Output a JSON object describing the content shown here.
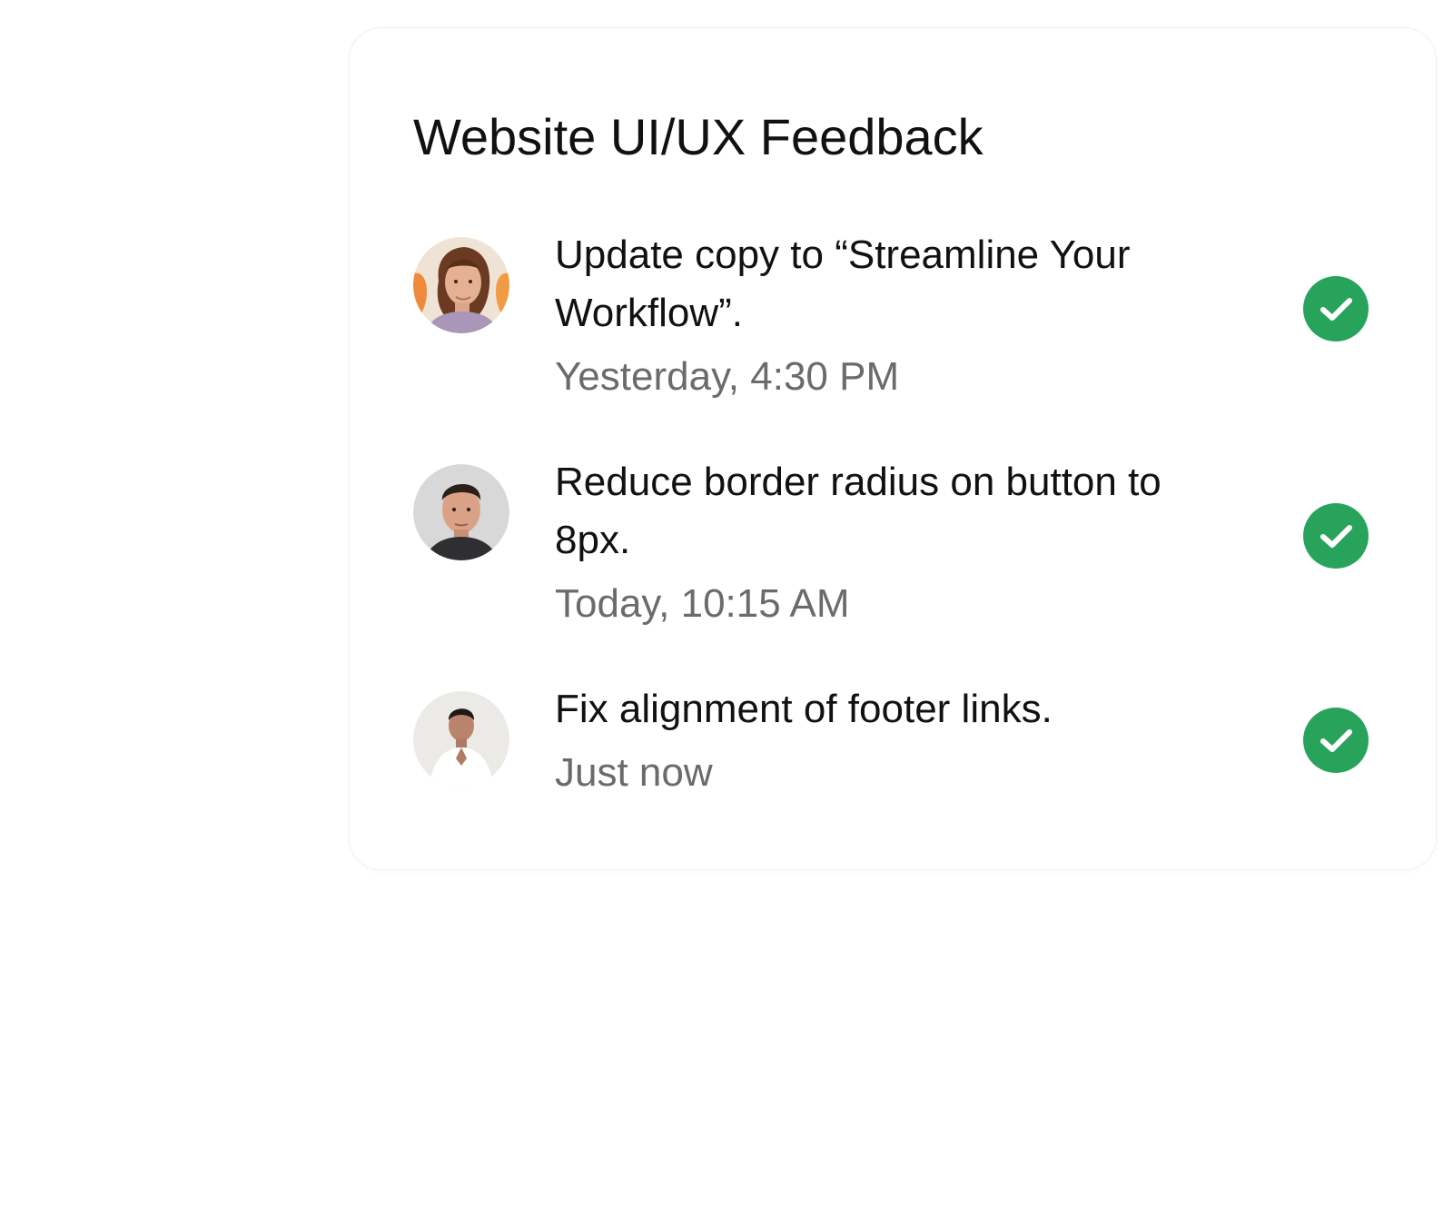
{
  "title": "Website UI/UX Feedback",
  "colors": {
    "check": "#27a35b",
    "meta": "#6b6b6b",
    "text": "#111111"
  },
  "items": [
    {
      "text": "Update copy to “Streamline Your\nWorkflow”.",
      "time": "Yesterday, 4:30 PM",
      "avatar_icon": "avatar-woman-curly-hair",
      "status_icon": "check-circle-icon"
    },
    {
      "text": "Reduce border radius on button to\n8px.",
      "time": "Today, 10:15 AM",
      "avatar_icon": "avatar-man-dark-shirt",
      "status_icon": "check-circle-icon"
    },
    {
      "text": "Fix alignment of footer links.",
      "time": "Just now",
      "avatar_icon": "avatar-man-white-shirt",
      "status_icon": "check-circle-icon"
    }
  ]
}
